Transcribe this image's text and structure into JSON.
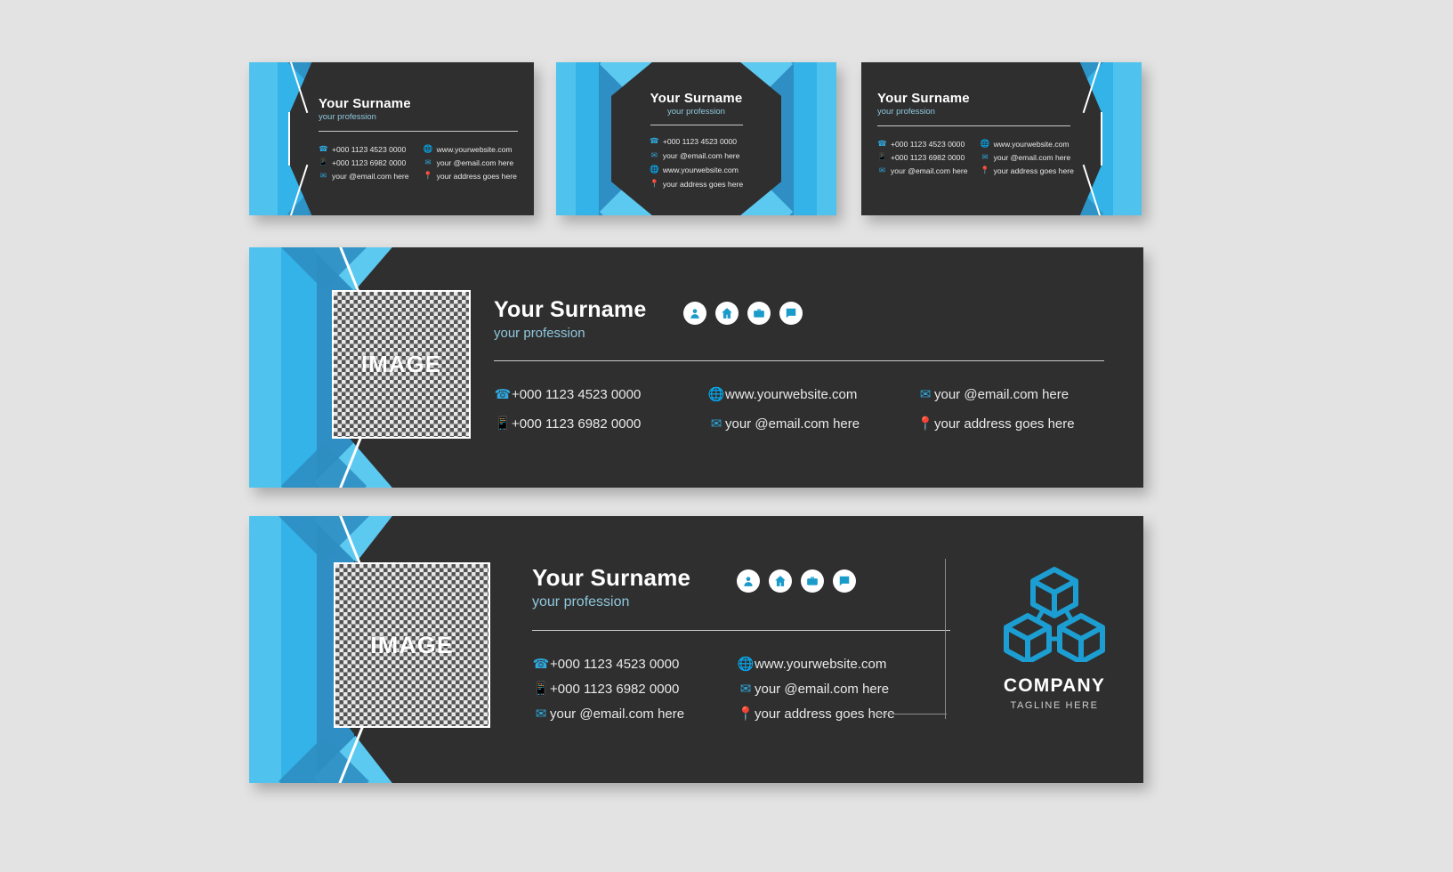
{
  "theme": {
    "page_bg": "#e3e3e3",
    "card_bg": "#2f2f2f",
    "accent_light": "#4fc3ee",
    "accent_mid": "#34b3e8",
    "accent_deep": "#2f8fc4",
    "icon_blue": "#2fa8dd",
    "text_white": "#ffffff",
    "profession_color": "#8fc7dd"
  },
  "identity": {
    "surname": "Your Surname",
    "profession": "your profession"
  },
  "contacts": {
    "phone": "+000 1123 4523 0000",
    "mobile": "+000 1123 6982 0000",
    "email": "your @email.com here",
    "website": "www.yourwebsite.com",
    "address": "your address goes here"
  },
  "image_placeholder": {
    "label": "IMAGE"
  },
  "social_icons": [
    {
      "name": "person-icon",
      "glyph": "person"
    },
    {
      "name": "home-icon",
      "glyph": "home"
    },
    {
      "name": "briefcase-icon",
      "glyph": "briefcase"
    },
    {
      "name": "chat-icon",
      "glyph": "chat"
    }
  ],
  "cards": [
    {
      "id": "card-left",
      "layout": "left-band",
      "contact_columns": [
        [
          {
            "icon": "phone-icon",
            "text": "+000 1123 4523 0000"
          },
          {
            "icon": "mobile-icon",
            "text": "+000 1123 6982 0000"
          },
          {
            "icon": "email-icon",
            "text": "your @email.com here"
          }
        ],
        [
          {
            "icon": "globe-icon",
            "text": "www.yourwebsite.com"
          },
          {
            "icon": "email-icon",
            "text": "your @email.com here"
          },
          {
            "icon": "location-icon",
            "text": "your address goes here"
          }
        ]
      ]
    },
    {
      "id": "card-center",
      "layout": "octagon",
      "contact_columns": [
        [
          {
            "icon": "phone-icon",
            "text": "+000 1123 4523 0000"
          },
          {
            "icon": "email-icon",
            "text": "your @email.com here"
          },
          {
            "icon": "globe-icon",
            "text": "www.yourwebsite.com"
          },
          {
            "icon": "location-icon",
            "text": "your address goes here"
          }
        ]
      ]
    },
    {
      "id": "card-right",
      "layout": "right-band",
      "contact_columns": [
        [
          {
            "icon": "phone-icon",
            "text": "+000 1123 4523 0000"
          },
          {
            "icon": "mobile-icon",
            "text": "+000 1123 6982 0000"
          },
          {
            "icon": "email-icon",
            "text": "your @email.com here"
          }
        ],
        [
          {
            "icon": "globe-icon",
            "text": "www.yourwebsite.com"
          },
          {
            "icon": "email-icon",
            "text": "your @email.com here"
          },
          {
            "icon": "location-icon",
            "text": "your address goes here"
          }
        ]
      ]
    }
  ],
  "banner_middle": {
    "id": "banner-email-signature-1",
    "contact_columns": [
      [
        {
          "icon": "phone-icon",
          "text": "+000 1123 4523 0000"
        },
        {
          "icon": "mobile-icon",
          "text": "+000 1123 6982 0000"
        }
      ],
      [
        {
          "icon": "globe-icon",
          "text": "www.yourwebsite.com"
        },
        {
          "icon": "email-icon",
          "text": "your @email.com here"
        }
      ],
      [
        {
          "icon": "email-icon",
          "text": "your @email.com here"
        },
        {
          "icon": "location-icon",
          "text": "your address goes here"
        }
      ]
    ]
  },
  "banner_bottom": {
    "id": "banner-email-signature-2",
    "contact_columns": [
      [
        {
          "icon": "phone-icon",
          "text": "+000 1123 4523 0000"
        },
        {
          "icon": "mobile-icon",
          "text": "+000 1123 6982 0000"
        },
        {
          "icon": "email-icon",
          "text": "your @email.com here"
        }
      ],
      [
        {
          "icon": "globe-icon",
          "text": "www.yourwebsite.com"
        },
        {
          "icon": "email-icon",
          "text": "your @email.com here"
        },
        {
          "icon": "location-icon",
          "text": "your address goes here"
        }
      ]
    ],
    "company": {
      "logo_name": "cubes-logo",
      "name": "COMPANY",
      "tagline": "TAGLINE HERE"
    }
  }
}
